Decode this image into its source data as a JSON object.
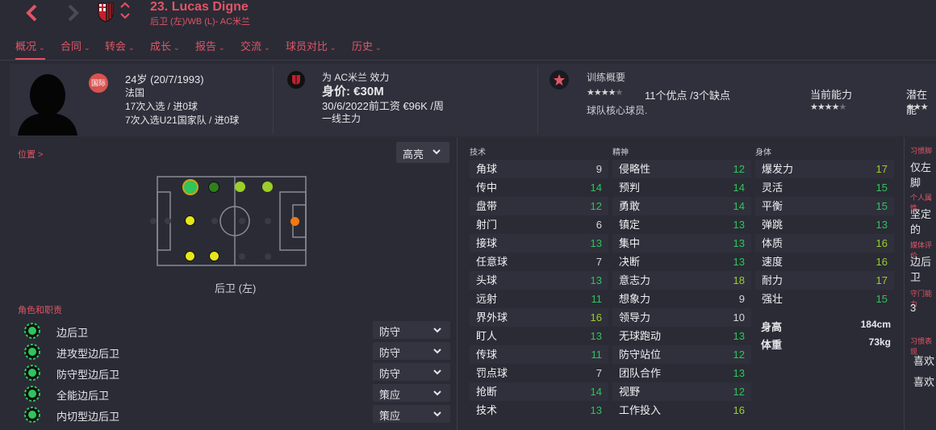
{
  "header": {
    "title": "23. Lucas Digne",
    "subtitle": "后卫 (左)/WB (L)- AC米兰"
  },
  "tabs": [
    {
      "label": "概况",
      "active": true
    },
    {
      "label": "合同"
    },
    {
      "label": "转会"
    },
    {
      "label": "成长"
    },
    {
      "label": "报告"
    },
    {
      "label": "交流"
    },
    {
      "label": "球员对比"
    },
    {
      "label": "历史"
    }
  ],
  "profile": {
    "badge": "国际",
    "age": "24岁 (20/7/1993)",
    "nationality": "法国",
    "caps": "17次入选 / 进0球",
    "u21_caps": "7次入选U21国家队 / 进0球"
  },
  "club": {
    "plays_for": "为 AC米兰 效力",
    "value": "身价: €30M",
    "contract": "30/6/2022前工资 €96K /周",
    "status": "一线主力"
  },
  "training": {
    "label": "训练概要",
    "stars_filled": 4,
    "stars_total": 5,
    "summary": "11个优点 /3个缺点",
    "description": "球队核心球员.",
    "current_ability_label": "当前能力",
    "current_ability_stars": 4,
    "potential_label": "潜在能"
  },
  "position": {
    "label": "位置 >",
    "dropdown": "高亮",
    "caption": "后卫 (左)"
  },
  "roles": {
    "label": "角色和职责",
    "items": [
      {
        "name": "边后卫",
        "duty": "防守"
      },
      {
        "name": "进攻型边后卫",
        "duty": "防守"
      },
      {
        "name": "防守型边后卫",
        "duty": "防守"
      },
      {
        "name": "全能边后卫",
        "duty": "策应"
      },
      {
        "name": "内切型边后卫",
        "duty": "策应"
      }
    ]
  },
  "attributes": {
    "technical_label": "技术",
    "mental_label": "精神",
    "physical_label": "身体",
    "technical": [
      {
        "name": "角球",
        "value": "9"
      },
      {
        "name": "传中",
        "value": "14"
      },
      {
        "name": "盘带",
        "value": "12"
      },
      {
        "name": "射门",
        "value": "6"
      },
      {
        "name": "接球",
        "value": "13"
      },
      {
        "name": "任意球",
        "value": "7"
      },
      {
        "name": "头球",
        "value": "13"
      },
      {
        "name": "远射",
        "value": "11"
      },
      {
        "name": "界外球",
        "value": "16"
      },
      {
        "name": "盯人",
        "value": "13"
      },
      {
        "name": "传球",
        "value": "11"
      },
      {
        "name": "罚点球",
        "value": "7"
      },
      {
        "name": "抢断",
        "value": "14"
      },
      {
        "name": "技术",
        "value": "13"
      }
    ],
    "mental": [
      {
        "name": "侵略性",
        "value": "12"
      },
      {
        "name": "预判",
        "value": "14"
      },
      {
        "name": "勇敢",
        "value": "14"
      },
      {
        "name": "镇定",
        "value": "13"
      },
      {
        "name": "集中",
        "value": "13"
      },
      {
        "name": "决断",
        "value": "13"
      },
      {
        "name": "意志力",
        "value": "18"
      },
      {
        "name": "想象力",
        "value": "9"
      },
      {
        "name": "领导力",
        "value": "10"
      },
      {
        "name": "无球跑动",
        "value": "13"
      },
      {
        "name": "防守站位",
        "value": "12"
      },
      {
        "name": "团队合作",
        "value": "13"
      },
      {
        "name": "视野",
        "value": "12"
      },
      {
        "name": "工作投入",
        "value": "16"
      }
    ],
    "physical": [
      {
        "name": "爆发力",
        "value": "17"
      },
      {
        "name": "灵活",
        "value": "15"
      },
      {
        "name": "平衡",
        "value": "15"
      },
      {
        "name": "弹跳",
        "value": "13"
      },
      {
        "name": "体质",
        "value": "16"
      },
      {
        "name": "速度",
        "value": "16"
      },
      {
        "name": "耐力",
        "value": "17"
      },
      {
        "name": "强壮",
        "value": "15"
      }
    ],
    "height_label": "身高",
    "height": "184cm",
    "weight_label": "体重",
    "weight": "73kg"
  },
  "right_panel": {
    "foot_label": "习惯脚",
    "foot_value": "仅左脚",
    "personality_label": "个人属性",
    "personality_value": "坚定的",
    "media_label": "媒体评价",
    "media_value": "边后卫",
    "defense_label": "守门能力",
    "defense_value": "3",
    "habits_label": "习惯表现",
    "habit1": "喜欢",
    "habit2": "喜欢"
  },
  "colors": {
    "accent": "#e05566",
    "high": "#9bcf2a",
    "mid": "#2ec55a",
    "low": "#d8d8d8"
  }
}
